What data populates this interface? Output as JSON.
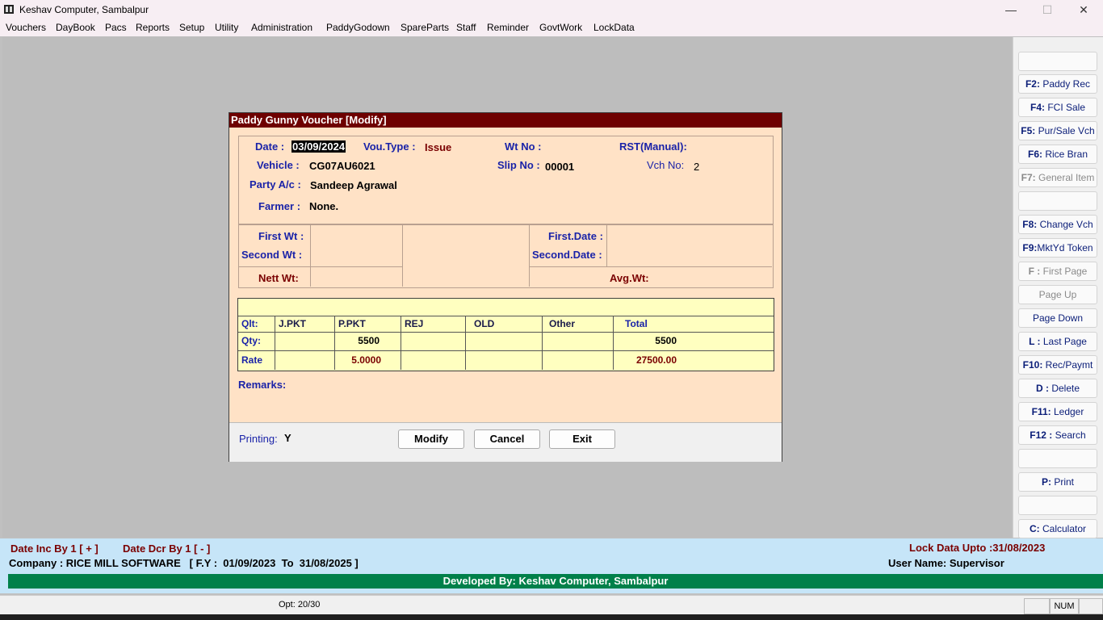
{
  "window": {
    "title": "Keshav Computer, Sambalpur",
    "minimize": "—",
    "maximize": "☐",
    "close": "✕"
  },
  "menu": [
    "Vouchers",
    "DayBook",
    "Pacs",
    "Reports",
    "Setup",
    "Utility",
    "Administration",
    "PaddyGodown",
    "SpareParts",
    "Staff",
    "Reminder",
    "GovtWork",
    "LockData"
  ],
  "sidebar": [
    {
      "key": "F2:",
      "label": "Paddy Rec",
      "enabled": true
    },
    {
      "key": "F4:",
      "label": "FCI Sale",
      "enabled": true
    },
    {
      "key": "F5:",
      "label": "Pur/Sale Vch",
      "enabled": true
    },
    {
      "key": "F6:",
      "label": "Rice Bran",
      "enabled": true
    },
    {
      "key": "F7:",
      "label": "General Item",
      "enabled": false
    },
    {
      "key": "F8:",
      "label": "Change  Vch",
      "enabled": true
    },
    {
      "key": "F9:",
      "label": "MktYd Token",
      "enabled": true
    },
    {
      "key": "F :",
      "label": "First Page",
      "enabled": false
    },
    {
      "key": "",
      "label": "Page Up",
      "enabled": false
    },
    {
      "key": "",
      "label": "Page Down",
      "enabled": true
    },
    {
      "key": "L :",
      "label": "Last Page",
      "enabled": true
    },
    {
      "key": "F10:",
      "label": "Rec/Paymt",
      "enabled": true
    },
    {
      "key": "D :",
      "label": "Delete",
      "enabled": true
    },
    {
      "key": "F11:",
      "label": "Ledger",
      "enabled": true
    },
    {
      "key": "F12 :",
      "label": "Search",
      "enabled": true
    },
    {
      "key": "P:",
      "label": "Print",
      "enabled": true
    },
    {
      "key": "C:",
      "label": "Calculator",
      "enabled": true
    }
  ],
  "dialog": {
    "title": "Paddy Gunny Voucher [Modify]",
    "date_label": "Date :",
    "date_value": "03/09/2024",
    "voutype_label": "Vou.Type :",
    "voutype_value": "Issue",
    "wtno_label": "Wt No :",
    "rst_label": "RST(Manual):",
    "vehicle_label": "Vehicle :",
    "vehicle_value": "CG07AU6021",
    "slipno_label": "Slip No :",
    "slipno_value": "00001",
    "vchno_label": "Vch No:",
    "vchno_value": "2",
    "party_label": "Party A/c :",
    "party_value": "Sandeep Agrawal",
    "farmer_label": "Farmer :",
    "farmer_value": "None.",
    "firstwt_label": "First Wt :",
    "secondwt_label": "Second Wt :",
    "nettwt_label": "Nett Wt:",
    "firstdate_label": "First.Date :",
    "seconddate_label": "Second.Date :",
    "avgwt_label": "Avg.Wt:",
    "grid": {
      "headers": [
        "Qlt:",
        "J.PKT",
        "P.PKT",
        "REJ",
        "OLD",
        "Other",
        "Total"
      ],
      "qty_label": "Qty:",
      "rate_label": "Rate",
      "qty": [
        "",
        "5500",
        "",
        "",
        "",
        "5500"
      ],
      "rate": [
        "",
        "5.0000",
        "",
        "",
        "",
        "27500.00"
      ]
    },
    "remarks_label": "Remarks:",
    "printing_label": "Printing:",
    "printing_value": "Y",
    "btn_modify": "Modify",
    "btn_cancel": "Cancel",
    "btn_exit": "Exit"
  },
  "status": {
    "date_inc": "Date Inc By 1 [ + ]",
    "date_dcr": "Date Dcr By 1 [ - ]",
    "lock_data": "Lock Data Upto :31/08/2023",
    "company": "Company : RICE MILL SOFTWARE   [ F.Y :  01/09/2023  To  31/08/2025 ]",
    "user": "User Name: Supervisor",
    "developed": "Developed By: Keshav Computer, Sambalpur",
    "opt": "Opt: 20/30",
    "num": "NUM"
  }
}
